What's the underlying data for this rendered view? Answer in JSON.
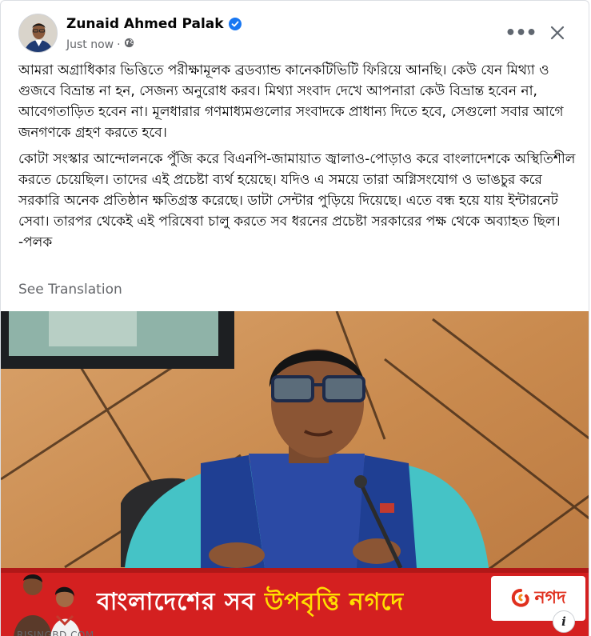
{
  "post": {
    "author": "Zunaid Ahmed Palak",
    "timestamp": "Just now",
    "separator": "·",
    "privacy_icon": "globe-icon",
    "verified_icon": "verified-badge-icon",
    "more_icon": "more-horizontal-icon",
    "more_label": "•••",
    "close_icon": "close-icon",
    "paragraph_1": "আমরা অগ্রাধিকার ভিত্তিতে পরীক্ষামূলক ব্রডব্যান্ড কানেকটিভিটি ফিরিয়ে আনছি। কেউ যেন মিথ্যা ও গুজবে বিভ্রান্ত না হন, সেজন্য অনুরোধ করব। মিথ্যা সংবাদ দেখে আপনারা কেউ বিভ্রান্ত হবেন না, আবেগতাড়িত হবেন না। মূলধারার গণমাধ্যমগুলোর সংবাদকে প্রাধান্য দিতে হবে, সেগুলো সবার আগে জনগণকে গ্রহণ করতে হবে।",
    "paragraph_2": "কোটা সংস্কার আন্দোলনকে পুঁজি করে বিএনপি-জামায়াত জ্বালাও-পোড়াও করে বাংলাদেশকে অস্থিতিশীল করতে চেয়েছিল। তাদের এই প্রচেষ্টা ব্যর্থ হয়েছে। যদিও এ সময়ে তারা অগ্নিসংযোগ ও ভাঙচুর করে সরকারি অনেক প্রতিষ্ঠান ক্ষতিগ্রস্ত করেছে। ডাটা সেন্টার পুড়িয়ে দিয়েছে। এতে বন্ধ হয়ে যায় ইন্টারনেট সেবা। তারপর থেকেই এই পরিষেবা চালু করতে সব ধরনের প্রচেষ্টা সরকারের পক্ষ থেকে অব্যাহত ছিল।\n-পলক",
    "see_translation": "See Translation"
  },
  "link_preview": {
    "banner_text_part1": "বাংলাদেশের সব ",
    "banner_text_part2": "উপবৃত্তি নগদে",
    "brand": "নগদ",
    "info_label": "i",
    "source": "RISINGBD.COM"
  },
  "colors": {
    "verified": "#1877f2",
    "banner_red": "#d42020",
    "banner_highlight": "#ffde00",
    "muted_text": "#65676b"
  }
}
